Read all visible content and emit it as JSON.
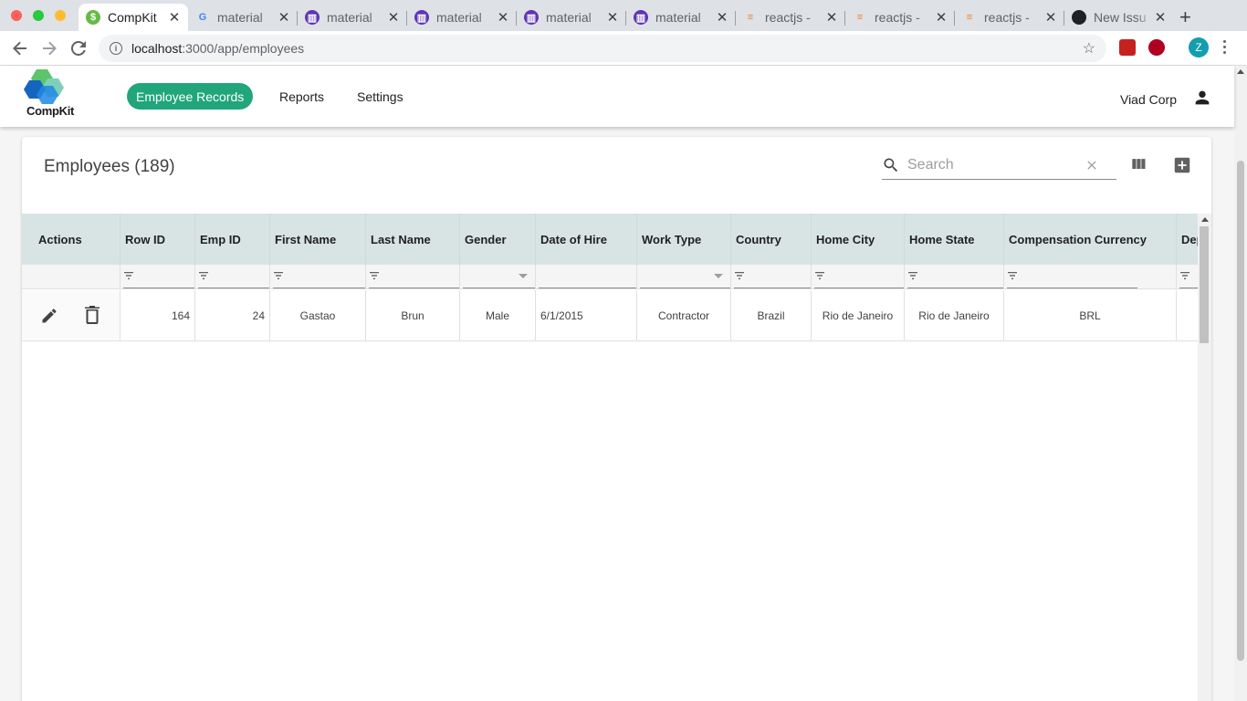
{
  "browser": {
    "tabs": [
      {
        "title": "CompKit",
        "icon": "compkit-favicon",
        "active": true
      },
      {
        "title": "material",
        "icon": "google-favicon"
      },
      {
        "title": "material",
        "icon": "material-ui-favicon"
      },
      {
        "title": "material",
        "icon": "material-ui-favicon"
      },
      {
        "title": "material",
        "icon": "material-ui-favicon"
      },
      {
        "title": "material",
        "icon": "material-ui-favicon"
      },
      {
        "title": "reactjs -",
        "icon": "stackoverflow-favicon"
      },
      {
        "title": "reactjs -",
        "icon": "stackoverflow-favicon"
      },
      {
        "title": "reactjs -",
        "icon": "stackoverflow-favicon"
      },
      {
        "title": "New Issu",
        "icon": "github-favicon"
      }
    ],
    "url_host": "localhost",
    "url_path": ":3000/app/employees",
    "profile_initial": "Z"
  },
  "app": {
    "logo_text": "CompKit",
    "nav": [
      "Employee Records",
      "Reports",
      "Settings"
    ],
    "org_name": "Viad Corp",
    "accent": "#20a67a"
  },
  "card": {
    "title": "Employees (189)",
    "search_placeholder": "Search"
  },
  "table": {
    "columns": [
      "Actions",
      "Row ID",
      "Emp ID",
      "First Name",
      "Last Name",
      "Gender",
      "Date of Hire",
      "Work Type",
      "Country",
      "Home City",
      "Home State",
      "Compensation Currency",
      "Dep"
    ],
    "rows": [
      {
        "row_id": "164",
        "emp_id": "24",
        "first_name": "Gastao",
        "last_name": "Brun",
        "gender": "Male",
        "date_of_hire": "6/1/2015",
        "work_type": "Contractor",
        "country": "Brazil",
        "home_city": "Rio de Janeiro",
        "home_state": "Rio de Janeiro",
        "currency": "BRL",
        "dep": ""
      }
    ]
  }
}
